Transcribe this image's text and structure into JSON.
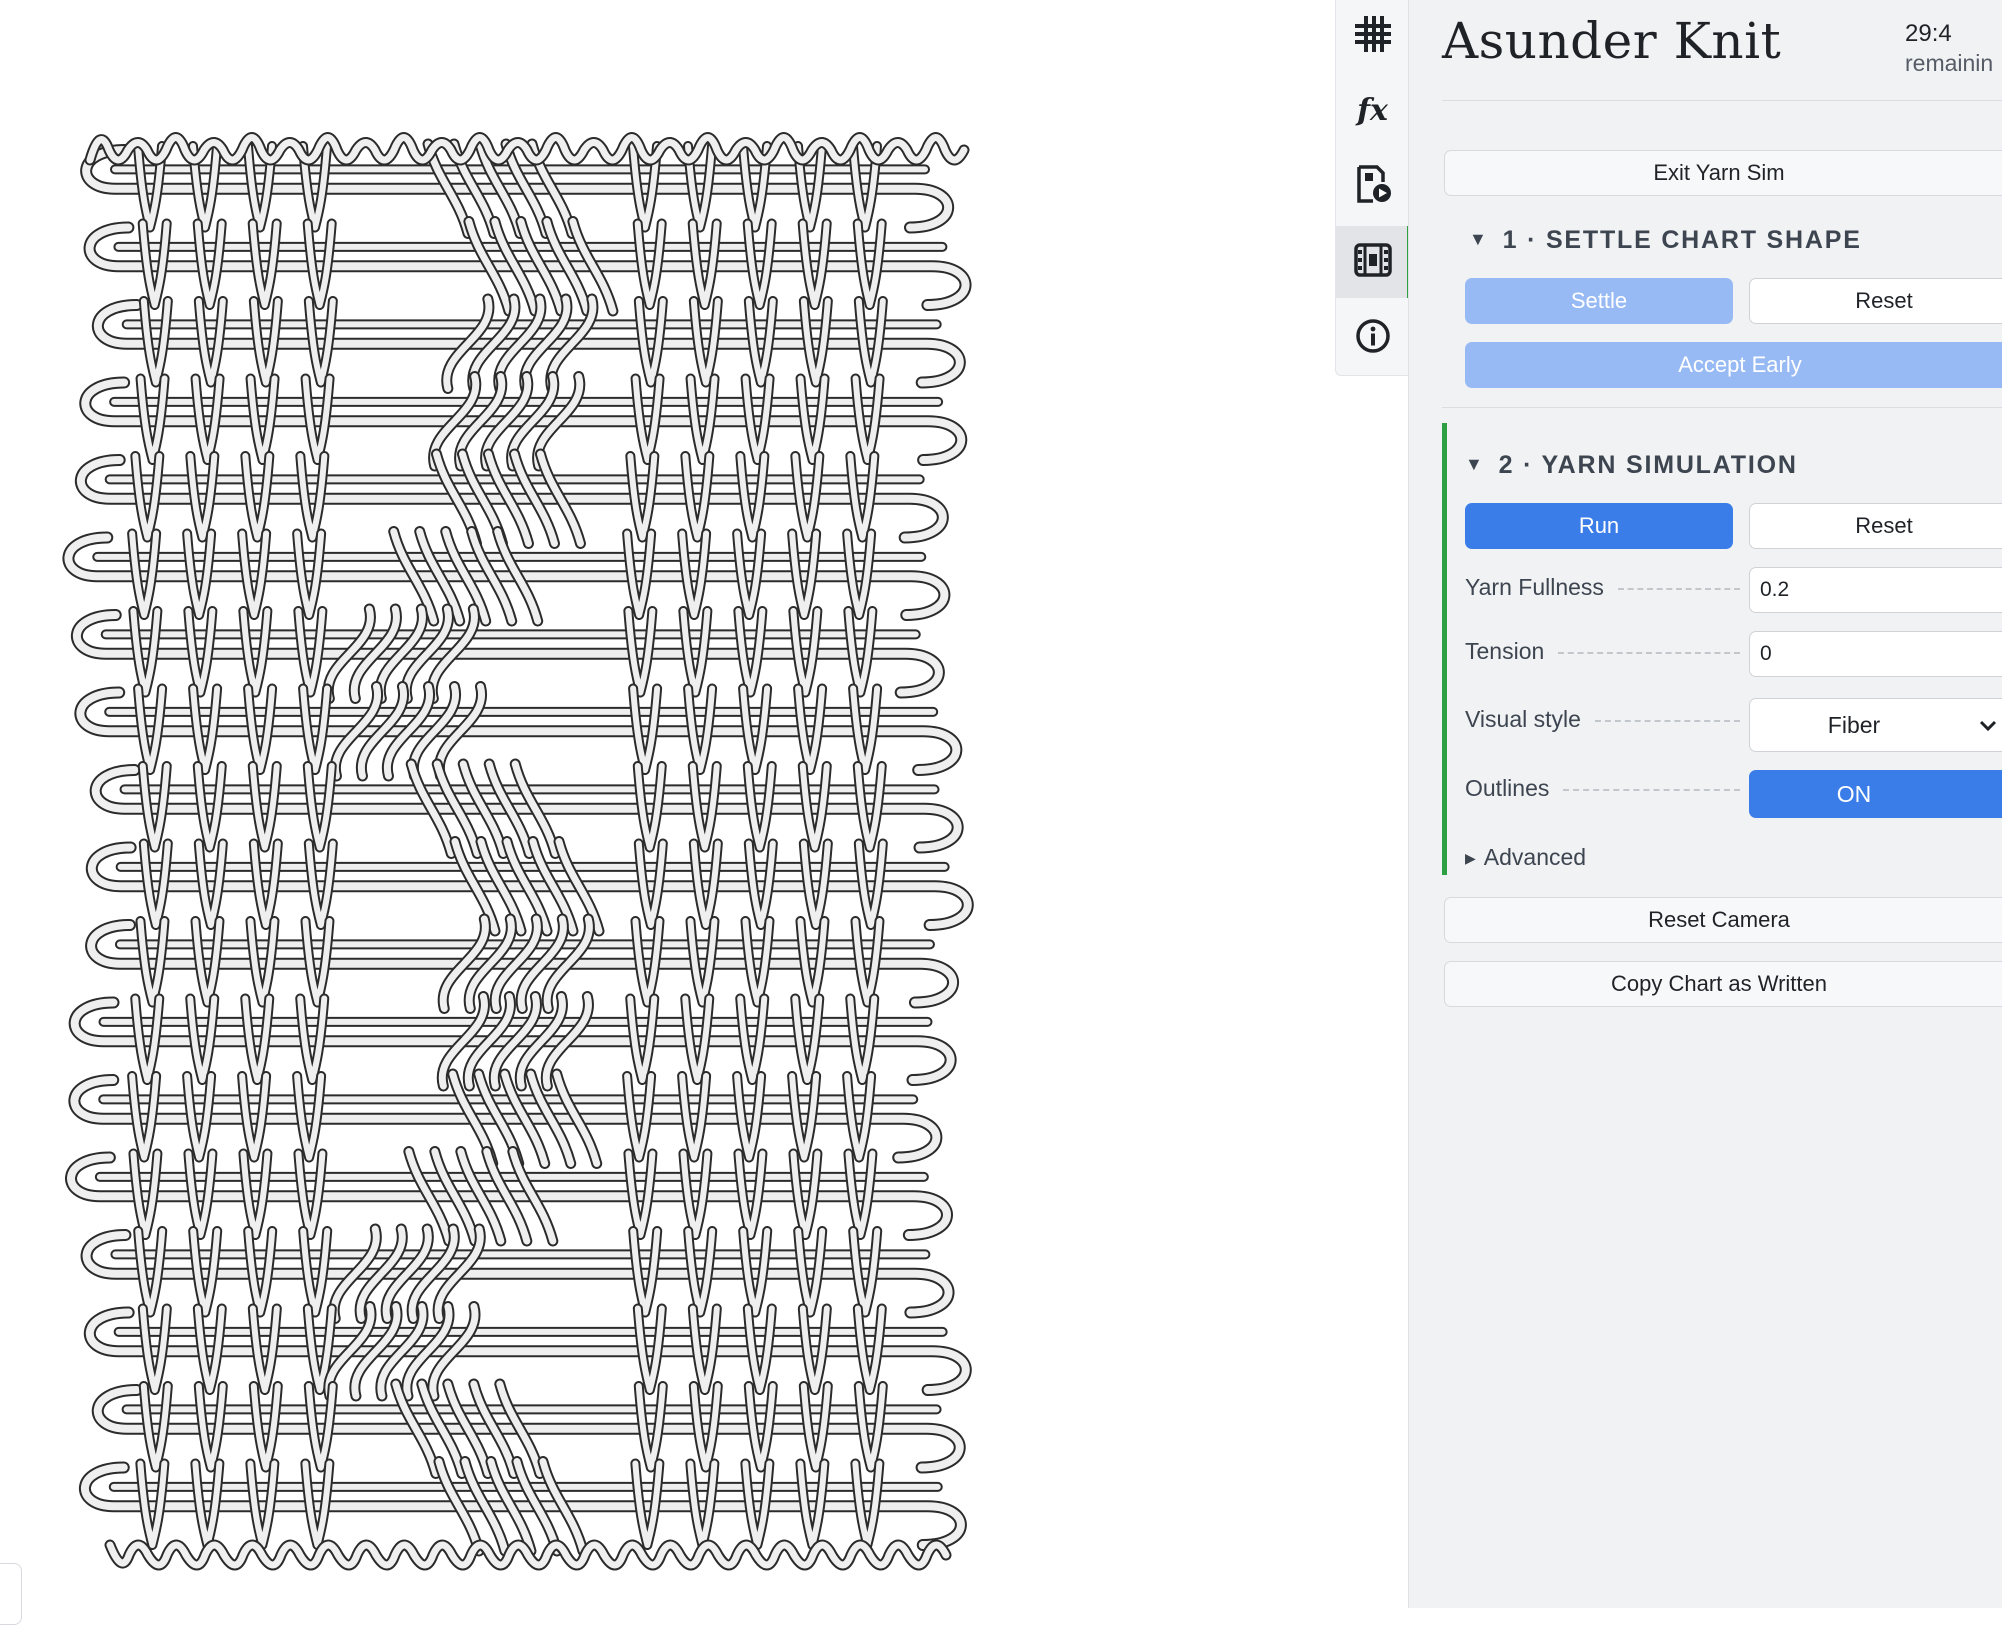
{
  "app": {
    "title": "Asunder Knit",
    "timer": "29:4",
    "timer_label": "remainin"
  },
  "rail": {
    "items": [
      {
        "name": "chart-grid",
        "icon": "hash-grid-icon",
        "active": false
      },
      {
        "name": "functions",
        "icon": "fx-icon",
        "glyph": "fx",
        "active": false
      },
      {
        "name": "simulation-export",
        "icon": "file-play-icon",
        "active": false
      },
      {
        "name": "yarn-sim",
        "icon": "film-strip-icon",
        "active": true
      },
      {
        "name": "info",
        "icon": "info-icon",
        "active": false
      }
    ]
  },
  "panel": {
    "exit_label": "Exit Yarn Sim",
    "settle": {
      "title": "1 · SETTLE CHART SHAPE",
      "settle_label": "Settle",
      "reset_label": "Reset",
      "accept_early_label": "Accept Early"
    },
    "simulation": {
      "title": "2 · YARN SIMULATION",
      "run_label": "Run",
      "reset_label": "Reset",
      "yarn_fullness_label": "Yarn Fullness",
      "yarn_fullness_value": "0.2",
      "tension_label": "Tension",
      "tension_value": "0",
      "visual_style_label": "Visual style",
      "visual_style_value": "Fiber",
      "outlines_label": "Outlines",
      "outlines_value": "ON",
      "advanced_label": "Advanced"
    },
    "reset_camera_label": "Reset Camera",
    "copy_chart_label": "Copy Chart as Written"
  },
  "colors": {
    "accent_blue": "#3a7de8",
    "accent_blue_disabled": "#98baf4",
    "active_green": "#2ea043",
    "yarn_fill": "#efefef",
    "yarn_outline": "#2b2b2b"
  }
}
